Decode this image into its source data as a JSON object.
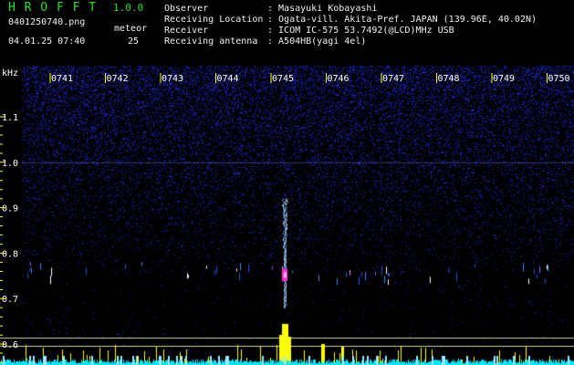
{
  "header": {
    "app_name": "H R O F F T",
    "version": "1.0.0",
    "filename": "0401250740.png",
    "datetime": "04.01.25 07:40",
    "meteor_label": "meteor",
    "meteor_count": "25",
    "info": [
      {
        "label": "Observer",
        "value": ": Masayuki Kobayashi"
      },
      {
        "label": "Receiving Location",
        "value": ": Ogata-vill. Akita-Pref. JAPAN (139.96E, 40.02N)"
      },
      {
        "label": "Receiver",
        "value": ": ICOM IC-575 53.7492(@LCD)MHz USB"
      },
      {
        "label": "Receiving antenna",
        "value": ": A504HB(yagi 4el)"
      }
    ]
  },
  "chart_data": {
    "type": "heatmap",
    "ylabel": "kHz",
    "time_ticks": [
      "0741",
      "0742",
      "0743",
      "0744",
      "0745",
      "0746",
      "0747",
      "0748",
      "0749",
      "0750"
    ],
    "freq_ticks": [
      "1.1",
      "1.0",
      "0.9",
      "0.8",
      "0.7",
      "0.6"
    ],
    "freq_values": [
      1.1,
      1.0,
      0.9,
      0.8,
      0.7,
      0.6
    ],
    "meteor_event": {
      "time": "0745",
      "freq_khz": 0.75
    },
    "colors": {
      "background": "#000000",
      "noise": "#1c2a9c",
      "signal": "#ff2ad0",
      "bars": "#ffff00",
      "baseline": "#00e8ff",
      "ticks": "#ffff00",
      "header_green": "#28e028"
    }
  }
}
